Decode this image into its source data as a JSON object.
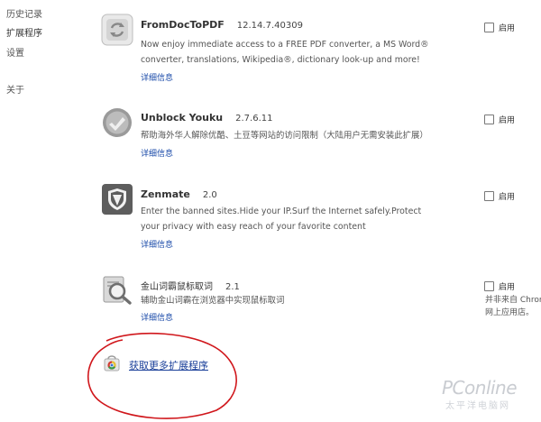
{
  "sidebar": {
    "items": [
      {
        "label": "历史记录"
      },
      {
        "label": "扩展程序"
      },
      {
        "label": "设置"
      },
      {
        "label": "关于"
      }
    ]
  },
  "extensions": [
    {
      "name": "FromDocToPDF",
      "version": "12.14.7.40309",
      "description": "Now enjoy immediate access to a FREE PDF converter, a MS Word® converter, translations, Wikipedia®, dictionary look-up and more!",
      "details": "详细信息",
      "enable_label": "启用",
      "enabled": false,
      "icon": "refresh-arrows-icon"
    },
    {
      "name": "Unblock Youku",
      "version": "2.7.6.11",
      "description": "帮助海外华人解除优酷、土豆等网站的访问限制（大陆用户无需安装此扩展）",
      "details": "详细信息",
      "enable_label": "启用",
      "enabled": false,
      "icon": "checkmark-badge-icon"
    },
    {
      "name": "Zenmate",
      "version": "2.0",
      "description": "Enter the banned sites.Hide your IP.Surf the Internet safely.Protect your privacy with easy reach of your favorite content",
      "details": "详细信息",
      "enable_label": "启用",
      "enabled": false,
      "icon": "shield-icon"
    },
    {
      "name": "金山词霸鼠标取词",
      "version": "2.1",
      "description": "辅助金山词霸在浏览器中实现鼠标取词",
      "details": "详细信息",
      "enable_label": "启用",
      "enabled": false,
      "icon": "magnifier-book-icon",
      "note_line1": "并非来自 Chrom",
      "note_line2": "网上应用店。"
    }
  ],
  "get_more": {
    "label": "获取更多扩展程序",
    "icon": "web-store-bag-icon"
  },
  "watermark": {
    "main": "PConline",
    "sub": "太平洋电脑网"
  },
  "colors": {
    "link": "#1a4aa8",
    "annotation_circle": "#d0161b"
  }
}
